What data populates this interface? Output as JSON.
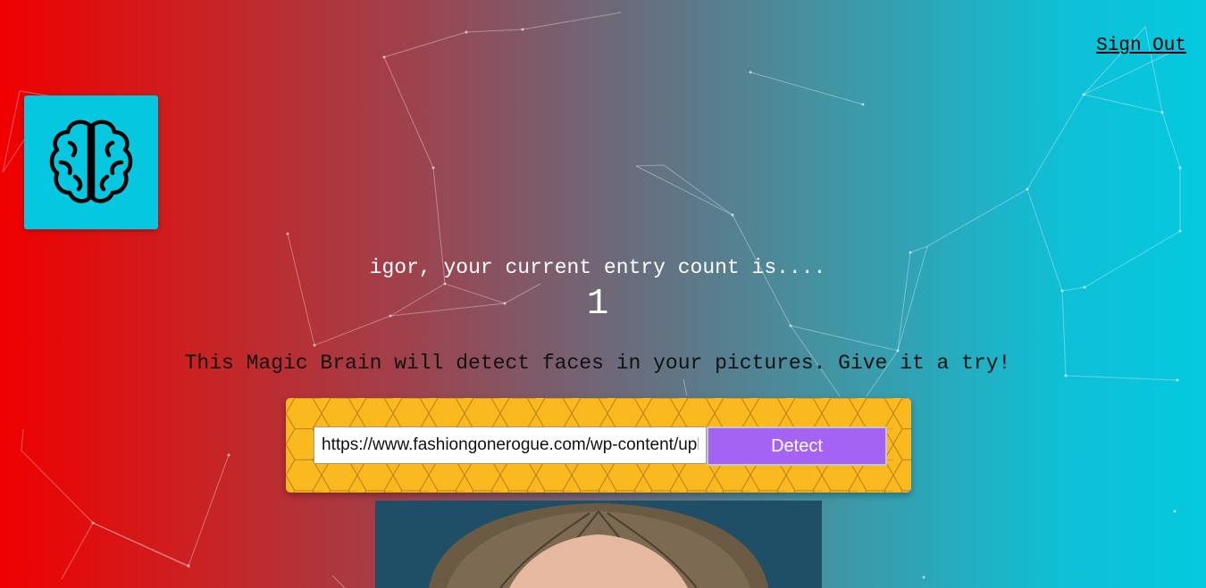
{
  "nav": {
    "sign_out": "Sign Out"
  },
  "logo": {
    "icon": "brain-icon"
  },
  "rank": {
    "greeting": "igor, your current entry count is....",
    "count": "1"
  },
  "tagline": "This Magic Brain will detect faces in your pictures. Give it a try!",
  "form": {
    "url_value": "https://www.fashiongonerogue.com/wp-content/uploads",
    "detect_label": "Detect"
  },
  "colors": {
    "accent_panel": "#fbb920",
    "button": "#a463f2",
    "logo_bg": "#05c8e0"
  }
}
